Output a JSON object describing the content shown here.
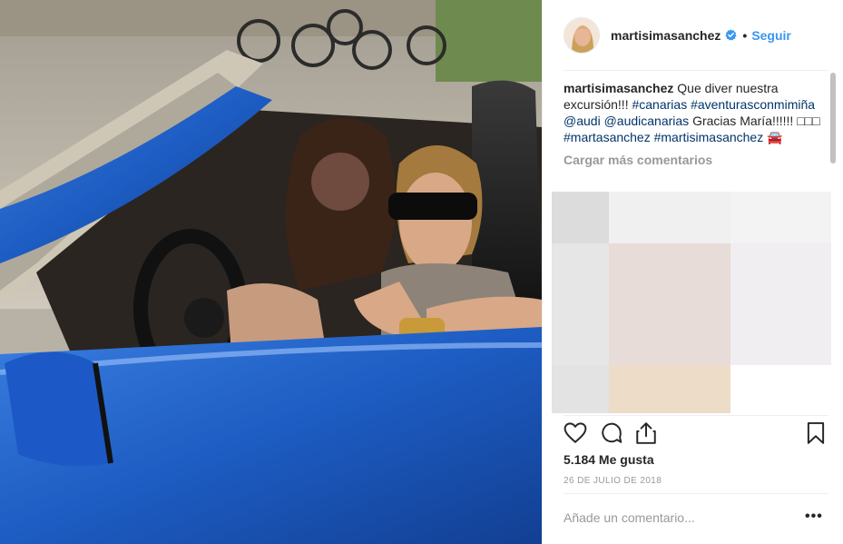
{
  "post": {
    "username": "martisimasanchez",
    "verified": true,
    "follow_label": "Seguir",
    "separator": "•"
  },
  "caption": {
    "username": "martisimasanchez",
    "text_1": " Que diver nuestra excursión!!! ",
    "tag_1": "#canarias",
    "tag_2": "#aventurasconmimiña",
    "mention_1": "@audi",
    "mention_2": "@audicanarias",
    "text_2": " Gracias María!!!!!! □□□ ",
    "tag_3": "#martasanchez",
    "tag_4": "#martisimasanchez",
    "emoji": "🚘"
  },
  "load_more_label": "Cargar más comentarios",
  "likes_text": "5.184 Me gusta",
  "date_text": "26 DE JULIO DE 2018",
  "comment_box": {
    "placeholder": "Añade un comentario...",
    "options_label": "•••"
  },
  "icons": {
    "like": "heart-icon",
    "comment": "comment-bubble-icon",
    "share": "share-icon",
    "save": "bookmark-icon",
    "verified": "verified-badge-icon"
  },
  "colors": {
    "link_blue": "#3897f0",
    "hashtag_blue": "#003569",
    "muted_gray": "#999999",
    "text": "#262626",
    "car_blue": "#1f5fc4"
  },
  "pixel_colors": [
    "#dcdcdc",
    "#f0f0f0",
    "#f3f3f3",
    "#e6e6e6",
    "#e8dcd8",
    "#f0eef0",
    "#e3e3e3",
    "#ecdcc8",
    "#ffffff"
  ]
}
